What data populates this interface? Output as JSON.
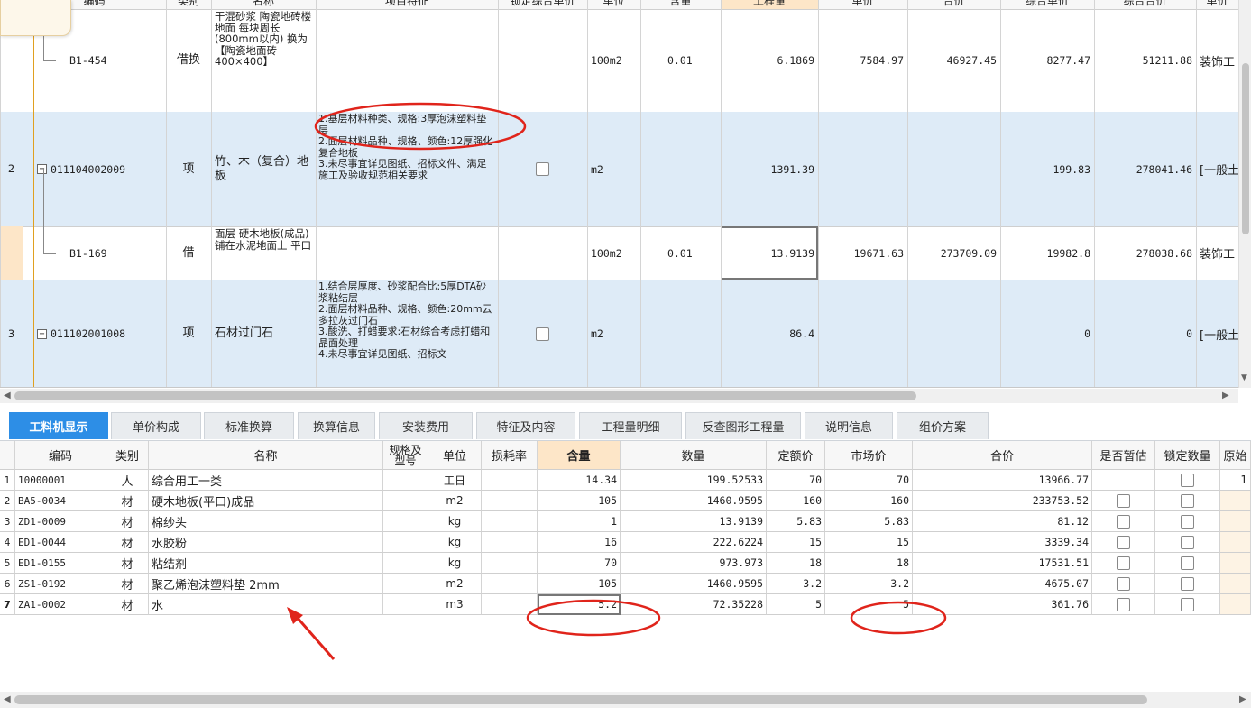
{
  "top_header": [
    "编码",
    "类别",
    "名称",
    "项目特征",
    "锁定综合单价",
    "单位",
    "含量",
    "工程量",
    "单价",
    "合价",
    "综合单价",
    "综合合价",
    "单价"
  ],
  "top_rows": [
    {
      "type": "sub",
      "no": "",
      "code": "B1-454",
      "kind": "借换",
      "name": "干混砂浆 陶瓷地砖楼地面 每块周长(800mm以内) 换为【陶瓷地面砖 400×400】",
      "feature": "",
      "unit": "100m2",
      "content": "0.01",
      "qty": "6.1869",
      "price": "7584.97",
      "total": "46927.45",
      "comp_price": "8277.47",
      "comp_total": "51211.88",
      "last": "装饰工"
    },
    {
      "type": "item",
      "no": "2",
      "code": "011104002009",
      "kind": "项",
      "name": "竹、木（复合）地板",
      "feature": "1.基层材料种类、规格:3厚泡沫塑料垫层\n2.面层材料品种、规格、颜色:12厚强化复合地板\n3.未尽事宜详见图纸、招标文件、满足施工及验收规范相关要求",
      "unit": "m2",
      "content": "",
      "qty": "1391.39",
      "price": "",
      "total": "",
      "comp_price": "199.83",
      "comp_total": "278041.46",
      "last": "[一般土"
    },
    {
      "type": "sub",
      "no": "",
      "code": "B1-169",
      "kind": "借",
      "name": "面层 硬木地板(成品) 铺在水泥地面上 平口",
      "feature": "",
      "unit": "100m2",
      "content": "0.01",
      "qty": "13.9139",
      "price": "19671.63",
      "total": "273709.09",
      "comp_price": "19982.8",
      "comp_total": "278038.68",
      "last": "装饰工"
    },
    {
      "type": "item",
      "no": "3",
      "code": "011102001008",
      "kind": "项",
      "name": "石材过门石",
      "feature": "1.结合层厚度、砂浆配合比:5厚DTA砂浆粘结层\n2.面层材料品种、规格、颜色:20mm云多拉灰过门石\n3.酸洗、打蜡要求:石材综合考虑打蜡和晶面处理\n4.未尽事宜详见图纸、招标文",
      "unit": "m2",
      "content": "",
      "qty": "86.4",
      "price": "",
      "total": "",
      "comp_price": "0",
      "comp_total": "0",
      "last": "[一般土"
    }
  ],
  "tabs": [
    "工料机显示",
    "单价构成",
    "标准换算",
    "换算信息",
    "安装费用",
    "特征及内容",
    "工程量明细",
    "反查图形工程量",
    "说明信息",
    "组价方案"
  ],
  "bottom_header": [
    "编码",
    "类别",
    "名称",
    "规格及型号",
    "单位",
    "损耗率",
    "含量",
    "数量",
    "定额价",
    "市场价",
    "合价",
    "是否暂估",
    "锁定数量",
    "原始"
  ],
  "bottom_rows": [
    {
      "no": "1",
      "code": "10000001",
      "kind": "人",
      "name": "综合用工一类",
      "spec": "",
      "unit": "工日",
      "loss": "",
      "content": "14.34",
      "qty": "199.52533",
      "quota": "70",
      "market": "70",
      "total": "13966.77",
      "est": false,
      "lock": true,
      "orig": "1"
    },
    {
      "no": "2",
      "code": "BA5-0034",
      "kind": "材",
      "name": "硬木地板(平口)成品",
      "spec": "",
      "unit": "m2",
      "loss": "",
      "content": "105",
      "qty": "1460.9595",
      "quota": "160",
      "market": "160",
      "total": "233753.52",
      "est": true,
      "lock": true,
      "orig": ""
    },
    {
      "no": "3",
      "code": "ZD1-0009",
      "kind": "材",
      "name": "棉纱头",
      "spec": "",
      "unit": "kg",
      "loss": "",
      "content": "1",
      "qty": "13.9139",
      "quota": "5.83",
      "market": "5.83",
      "total": "81.12",
      "est": true,
      "lock": true,
      "orig": ""
    },
    {
      "no": "4",
      "code": "ED1-0044",
      "kind": "材",
      "name": "水胶粉",
      "spec": "",
      "unit": "kg",
      "loss": "",
      "content": "16",
      "qty": "222.6224",
      "quota": "15",
      "market": "15",
      "total": "3339.34",
      "est": true,
      "lock": true,
      "orig": ""
    },
    {
      "no": "5",
      "code": "ED1-0155",
      "kind": "材",
      "name": "粘结剂",
      "spec": "",
      "unit": "kg",
      "loss": "",
      "content": "70",
      "qty": "973.973",
      "quota": "18",
      "market": "18",
      "total": "17531.51",
      "est": true,
      "lock": true,
      "orig": ""
    },
    {
      "no": "6",
      "code": "ZS1-0192",
      "kind": "材",
      "name": "聚乙烯泡沫塑料垫 2mm",
      "spec": "",
      "unit": "m2",
      "loss": "",
      "content": "105",
      "qty": "1460.9595",
      "quota": "3.2",
      "market": "3.2",
      "total": "4675.07",
      "est": true,
      "lock": true,
      "orig": ""
    },
    {
      "no": "7",
      "code": "ZA1-0002",
      "kind": "材",
      "name": "水",
      "spec": "",
      "unit": "m3",
      "loss": "",
      "content": "5.2",
      "qty": "72.35228",
      "quota": "5",
      "market": "5",
      "total": "361.76",
      "est": true,
      "lock": true,
      "orig": ""
    }
  ],
  "colors": {
    "tab_active": "#2d8ee6",
    "row_highlight": "#deebf7",
    "annotation": "#e0241b",
    "header_highlight": "#fde6c8"
  }
}
